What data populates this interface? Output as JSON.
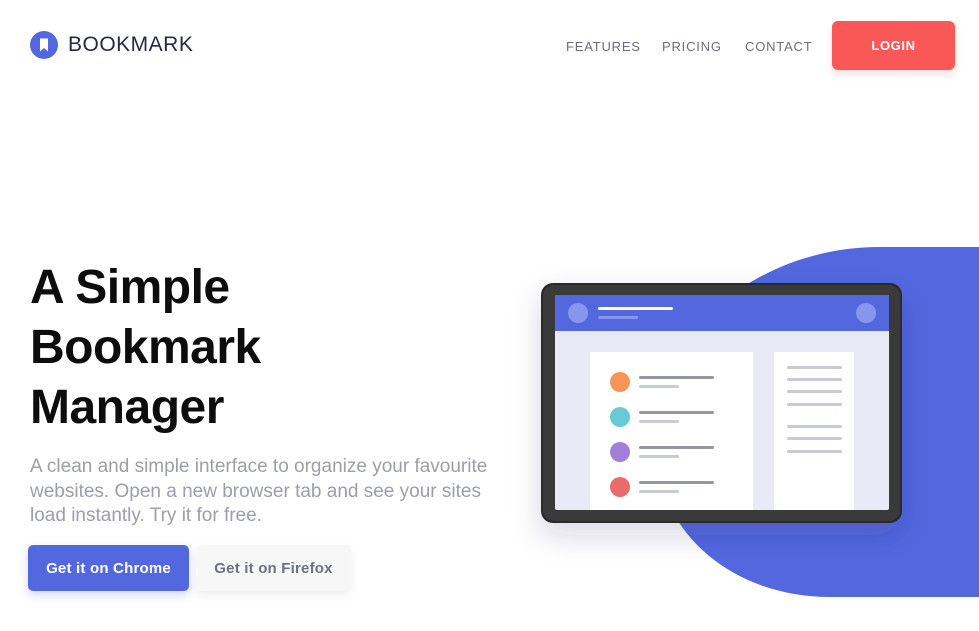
{
  "header": {
    "brand": "BOOKMARK",
    "logo_icon": "bookmark-icon",
    "nav": [
      {
        "label": "FEATURES"
      },
      {
        "label": "PRICING"
      },
      {
        "label": "CONTACT"
      }
    ],
    "login_label": "LOGIN"
  },
  "hero": {
    "title_lines": [
      "A Simple",
      "Bookmark",
      "Manager"
    ],
    "description": "A clean and simple interface to organize your favourite websites. Open a new browser tab and see your sites load instantly. Try it for free.",
    "chrome_button": "Get it on Chrome",
    "firefox_button": "Get it on Firefox"
  },
  "colors": {
    "primary": "#5368df",
    "accent": "#fa5757",
    "heading": "#0d0d0d",
    "muted": "#9c9ea9",
    "brand_text": "#252b46"
  },
  "illustration": {
    "bookmark_dot_colors": [
      "#f89456",
      "#6ac9d7",
      "#a27fd6",
      "#ea6b6b"
    ]
  }
}
